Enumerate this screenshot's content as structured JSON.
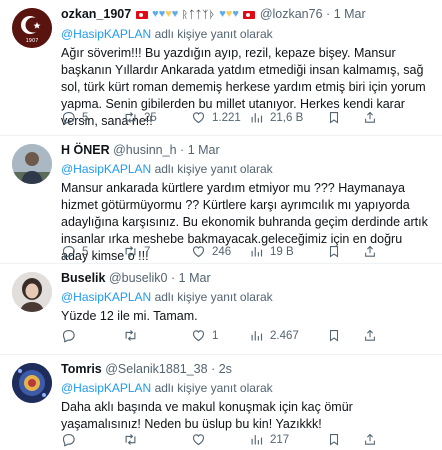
{
  "reply_prefix": "adlı kişiye yanıt olarak",
  "tweets": [
    {
      "name": "ozkan_1907",
      "glyphs": "ᚱᛏᛏᛉᚦ",
      "handle": "@lozkan76",
      "dot": "·",
      "date": "1 Mar",
      "reply_to": "@HasipKAPLAN",
      "reply_suffix": "adlı kişiye yanıt olarak",
      "text": "Ağır söverim!!! Bu yazdığın ayıp, rezil, kepaze bişey. Mansur başkanın Yıllardır Ankarada yatdım etmediği insan kalmamış, sağ sol, türk kürt roman dememiş herkese yardım etmiş biri için yorum yapma. Senin gibilerden bu millet utanıyor. Herkes kendi karar versin, sana ne!!",
      "replies": "5",
      "retweets": "25",
      "likes": "1.221",
      "views": "21,6 B"
    },
    {
      "name": "H ÖNER",
      "handle": "@husinn_h",
      "dot": "·",
      "date": "1 Mar",
      "reply_to": "@HasipKAPLAN",
      "reply_suffix": "adlı kişiye yanıt olarak",
      "text": "Mansur ankarada kürtlere yardım etmiyor mu ??? Haymanaya hizmet götürmüyormu ?? Kürtlere karşı ayrımcılık mı yapıyorda adaylığına karşısınız. Bu ekonomik buhranda geçim derdinde artık insanlar ırka meshebe bakmayacak.geleceğimiz için en doğru aday kimse o !!!",
      "replies": "5",
      "retweets": "7",
      "likes": "246",
      "views": "19 B"
    },
    {
      "name": "Buselik",
      "handle": "@buselik0",
      "dot": "·",
      "date": "1 Mar",
      "reply_to": "@HasipKAPLAN",
      "reply_suffix": "adlı kişiye yanıt olarak",
      "text": "Yüzde 12 ile mi. Tamam.",
      "replies": "",
      "retweets": "",
      "likes": "1",
      "views": "2.467"
    },
    {
      "name": "Tomris",
      "handle": "@Selanik1881_38",
      "dot": "·",
      "date": "2s",
      "reply_to": "@HasipKAPLAN",
      "reply_suffix": "adlı kişiye yanıt olarak",
      "text": "Daha aklı başında ve makul konuşmak için kaç ömür yaşamalısınız! Neden bu üslup bu kin! Yazıkkk!",
      "replies": "",
      "retweets": "",
      "likes": "",
      "views": "217"
    }
  ],
  "colors": {
    "text": "#0f1419",
    "secondary": "#536471",
    "link": "#1d9bf0",
    "divider": "#eff3f4"
  }
}
